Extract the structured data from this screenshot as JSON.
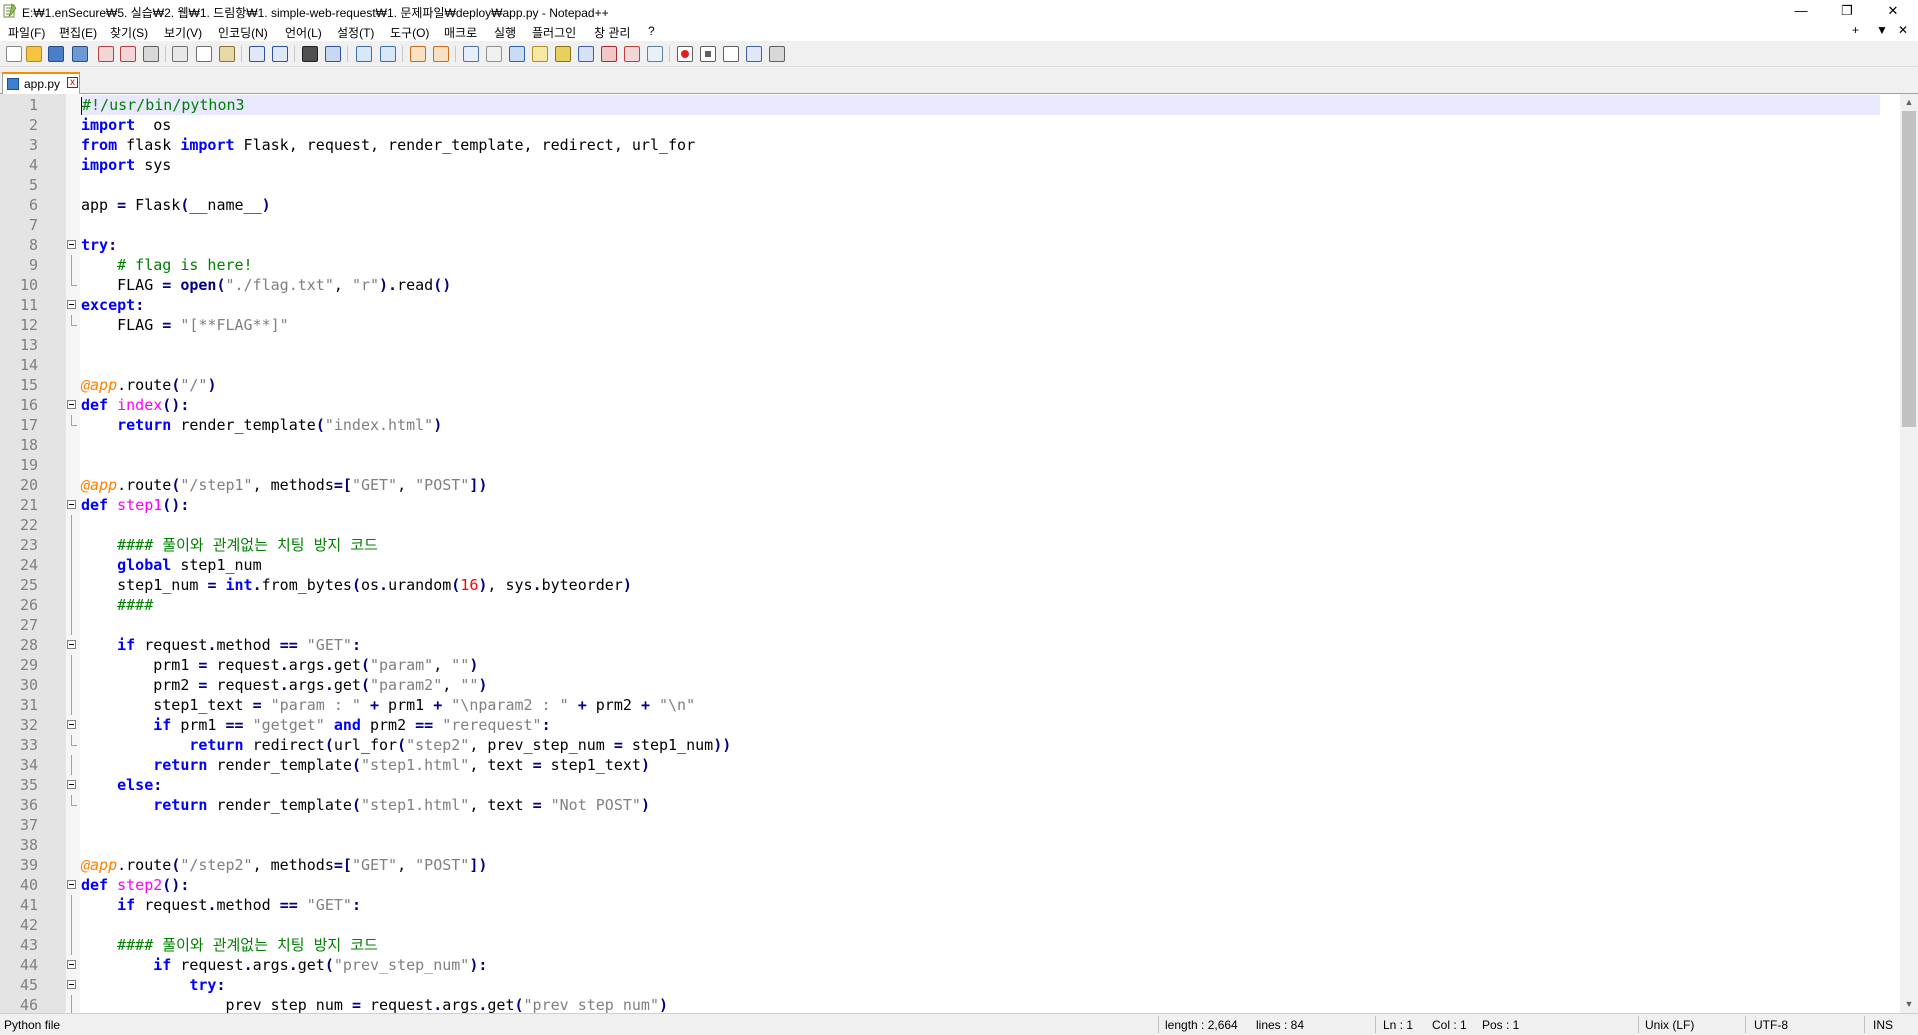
{
  "window": {
    "title": "E:₩1.enSecure₩5. 실습₩2. 웹₩1. 드림항₩1. simple-web-request₩1. 문제파일₩deploy₩app.py - Notepad++",
    "minimize": "—",
    "restore": "❐",
    "close": "✕"
  },
  "menu": {
    "items": [
      "파일(F)",
      "편집(E)",
      "찾기(S)",
      "보기(V)",
      "인코딩(N)",
      "언어(L)",
      "설정(T)",
      "도구(O)",
      "매크로",
      "실행",
      "플러그인",
      "창 관리",
      "?"
    ],
    "right_plus": "+",
    "right_down": "▼",
    "right_close": "✕"
  },
  "toolbar": {
    "icons": [
      "new-file",
      "open-file",
      "save",
      "save-all",
      "close",
      "close-all",
      "print",
      "cut",
      "copy",
      "paste",
      "undo",
      "redo",
      "find",
      "replace",
      "zoom-in",
      "zoom-out",
      "sync-vertical",
      "sync-horizontal",
      "word-wrap",
      "show-all-chars",
      "indent-guide",
      "user-language",
      "doc-map",
      "function-list",
      "folder-workspace",
      "doc-switcher",
      "monitoring",
      "record-macro",
      "stop-macro",
      "play-macro",
      "run-macro-multiple",
      "save-macro"
    ]
  },
  "tab": {
    "label": "app.py",
    "close": "x"
  },
  "colors": {
    "keyword": "#0000ff",
    "string": "#808080",
    "comment": "#008000",
    "number": "#ff0000",
    "decorator": "#ff8000",
    "function_name": "#ff00ff",
    "operator": "#000080",
    "current_line": "#e8e8ff",
    "tab_accent": "#fa8c00"
  },
  "editor": {
    "current_line": 1,
    "lines": [
      {
        "n": "1",
        "tokens": [
          [
            "cmt",
            "#!/usr/bin/python3"
          ]
        ]
      },
      {
        "n": "2",
        "tokens": [
          [
            "kw",
            "import"
          ],
          [
            "",
            "  os"
          ]
        ]
      },
      {
        "n": "3",
        "tokens": [
          [
            "kw",
            "from"
          ],
          [
            "",
            " flask "
          ],
          [
            "kw",
            "import"
          ],
          [
            "",
            " Flask, request, render_template, redirect, url_for"
          ]
        ]
      },
      {
        "n": "4",
        "tokens": [
          [
            "kw",
            "import"
          ],
          [
            "",
            " sys"
          ]
        ]
      },
      {
        "n": "5",
        "tokens": []
      },
      {
        "n": "6",
        "tokens": [
          [
            "",
            "app "
          ],
          [
            "op",
            "="
          ],
          [
            "",
            " Flask"
          ],
          [
            "op",
            "("
          ],
          [
            "",
            "__name__"
          ],
          [
            "op",
            ")"
          ]
        ]
      },
      {
        "n": "7",
        "tokens": []
      },
      {
        "n": "8",
        "fold": "start",
        "tokens": [
          [
            "kw",
            "try"
          ],
          [
            "op",
            ":"
          ]
        ]
      },
      {
        "n": "9",
        "fold": "line",
        "tokens": [
          [
            "",
            "    "
          ],
          [
            "cmt",
            "# flag is here!"
          ]
        ]
      },
      {
        "n": "10",
        "fold": "end",
        "tokens": [
          [
            "",
            "    FLAG "
          ],
          [
            "op",
            "="
          ],
          [
            "",
            " "
          ],
          [
            "kw2",
            "open"
          ],
          [
            "op",
            "("
          ],
          [
            "str",
            "\"./flag.txt\""
          ],
          [
            "",
            ", "
          ],
          [
            "str",
            "\"r\""
          ],
          [
            "op",
            ")."
          ],
          [
            "",
            "read"
          ],
          [
            "op",
            "()"
          ]
        ]
      },
      {
        "n": "11",
        "fold": "start",
        "tokens": [
          [
            "kw",
            "except"
          ],
          [
            "op",
            ":"
          ]
        ]
      },
      {
        "n": "12",
        "fold": "end",
        "tokens": [
          [
            "",
            "    FLAG "
          ],
          [
            "op",
            "="
          ],
          [
            "",
            " "
          ],
          [
            "str",
            "\"[**FLAG**]\""
          ]
        ]
      },
      {
        "n": "13",
        "tokens": []
      },
      {
        "n": "14",
        "tokens": []
      },
      {
        "n": "15",
        "tokens": [
          [
            "deco",
            "@app"
          ],
          [
            "",
            ".route"
          ],
          [
            "op",
            "("
          ],
          [
            "str",
            "\"/\""
          ],
          [
            "op",
            ")"
          ]
        ]
      },
      {
        "n": "16",
        "fold": "start",
        "tokens": [
          [
            "kw",
            "def"
          ],
          [
            "",
            " "
          ],
          [
            "fn",
            "index"
          ],
          [
            "op",
            "():"
          ]
        ]
      },
      {
        "n": "17",
        "fold": "end",
        "tokens": [
          [
            "",
            "    "
          ],
          [
            "kw",
            "return"
          ],
          [
            "",
            " render_template"
          ],
          [
            "op",
            "("
          ],
          [
            "str",
            "\"index.html\""
          ],
          [
            "op",
            ")"
          ]
        ]
      },
      {
        "n": "18",
        "tokens": []
      },
      {
        "n": "19",
        "tokens": []
      },
      {
        "n": "20",
        "tokens": [
          [
            "deco",
            "@app"
          ],
          [
            "",
            ".route"
          ],
          [
            "op",
            "("
          ],
          [
            "str",
            "\"/step1\""
          ],
          [
            "",
            ", methods"
          ],
          [
            "op",
            "=["
          ],
          [
            "str",
            "\"GET\""
          ],
          [
            "",
            ", "
          ],
          [
            "str",
            "\"POST\""
          ],
          [
            "op",
            "])"
          ]
        ]
      },
      {
        "n": "21",
        "fold": "start",
        "tokens": [
          [
            "kw",
            "def"
          ],
          [
            "",
            " "
          ],
          [
            "fn",
            "step1"
          ],
          [
            "op",
            "():"
          ]
        ]
      },
      {
        "n": "22",
        "fold": "line",
        "tokens": []
      },
      {
        "n": "23",
        "fold": "line",
        "tokens": [
          [
            "",
            "    "
          ],
          [
            "cmt",
            "#### 풀이와 관계없는 치팅 방지 코드"
          ]
        ]
      },
      {
        "n": "24",
        "fold": "line",
        "tokens": [
          [
            "",
            "    "
          ],
          [
            "kw",
            "global"
          ],
          [
            "",
            " step1_num"
          ]
        ]
      },
      {
        "n": "25",
        "fold": "line",
        "tokens": [
          [
            "",
            "    step1_num "
          ],
          [
            "op",
            "="
          ],
          [
            "",
            " "
          ],
          [
            "kw",
            "int"
          ],
          [
            "op",
            "."
          ],
          [
            "",
            "from_bytes"
          ],
          [
            "op",
            "("
          ],
          [
            "",
            "os"
          ],
          [
            "op",
            "."
          ],
          [
            "",
            "urandom"
          ],
          [
            "op",
            "("
          ],
          [
            "num",
            "16"
          ],
          [
            "op",
            ")"
          ],
          [
            "",
            ", sys"
          ],
          [
            "op",
            "."
          ],
          [
            "",
            "byteorder"
          ],
          [
            "op",
            ")"
          ]
        ]
      },
      {
        "n": "26",
        "fold": "line",
        "tokens": [
          [
            "",
            "    "
          ],
          [
            "cmt",
            "####"
          ]
        ]
      },
      {
        "n": "27",
        "fold": "line",
        "tokens": []
      },
      {
        "n": "28",
        "fold": "start",
        "tokens": [
          [
            "",
            "    "
          ],
          [
            "kw",
            "if"
          ],
          [
            "",
            " request"
          ],
          [
            "op",
            "."
          ],
          [
            "",
            "method "
          ],
          [
            "op",
            "=="
          ],
          [
            "",
            " "
          ],
          [
            "str",
            "\"GET\""
          ],
          [
            "op",
            ":"
          ]
        ]
      },
      {
        "n": "29",
        "fold": "line",
        "tokens": [
          [
            "",
            "        prm1 "
          ],
          [
            "op",
            "="
          ],
          [
            "",
            " request"
          ],
          [
            "op",
            "."
          ],
          [
            "",
            "args"
          ],
          [
            "op",
            "."
          ],
          [
            "",
            "get"
          ],
          [
            "op",
            "("
          ],
          [
            "str",
            "\"param\""
          ],
          [
            "",
            ", "
          ],
          [
            "str",
            "\"\""
          ],
          [
            "op",
            ")"
          ]
        ]
      },
      {
        "n": "30",
        "fold": "line",
        "tokens": [
          [
            "",
            "        prm2 "
          ],
          [
            "op",
            "="
          ],
          [
            "",
            " request"
          ],
          [
            "op",
            "."
          ],
          [
            "",
            "args"
          ],
          [
            "op",
            "."
          ],
          [
            "",
            "get"
          ],
          [
            "op",
            "("
          ],
          [
            "str",
            "\"param2\""
          ],
          [
            "",
            ", "
          ],
          [
            "str",
            "\"\""
          ],
          [
            "op",
            ")"
          ]
        ]
      },
      {
        "n": "31",
        "fold": "line",
        "tokens": [
          [
            "",
            "        step1_text "
          ],
          [
            "op",
            "="
          ],
          [
            "",
            " "
          ],
          [
            "str",
            "\"param : \""
          ],
          [
            "",
            " "
          ],
          [
            "op",
            "+"
          ],
          [
            "",
            " prm1 "
          ],
          [
            "op",
            "+"
          ],
          [
            "",
            " "
          ],
          [
            "str",
            "\"\\nparam2 : \""
          ],
          [
            "",
            " "
          ],
          [
            "op",
            "+"
          ],
          [
            "",
            " prm2 "
          ],
          [
            "op",
            "+"
          ],
          [
            "",
            " "
          ],
          [
            "str",
            "\"\\n\""
          ]
        ]
      },
      {
        "n": "32",
        "fold": "start",
        "tokens": [
          [
            "",
            "        "
          ],
          [
            "kw",
            "if"
          ],
          [
            "",
            " prm1 "
          ],
          [
            "op",
            "=="
          ],
          [
            "",
            " "
          ],
          [
            "str",
            "\"getget\""
          ],
          [
            "",
            " "
          ],
          [
            "kw",
            "and"
          ],
          [
            "",
            " prm2 "
          ],
          [
            "op",
            "=="
          ],
          [
            "",
            " "
          ],
          [
            "str",
            "\"rerequest\""
          ],
          [
            "op",
            ":"
          ]
        ]
      },
      {
        "n": "33",
        "fold": "end",
        "tokens": [
          [
            "",
            "            "
          ],
          [
            "kw",
            "return"
          ],
          [
            "",
            " redirect"
          ],
          [
            "op",
            "("
          ],
          [
            "",
            "url_for"
          ],
          [
            "op",
            "("
          ],
          [
            "str",
            "\"step2\""
          ],
          [
            "",
            ", prev_step_num "
          ],
          [
            "op",
            "="
          ],
          [
            "",
            " step1_num"
          ],
          [
            "op",
            "))"
          ]
        ]
      },
      {
        "n": "34",
        "fold": "line",
        "tokens": [
          [
            "",
            "        "
          ],
          [
            "kw",
            "return"
          ],
          [
            "",
            " render_template"
          ],
          [
            "op",
            "("
          ],
          [
            "str",
            "\"step1.html\""
          ],
          [
            "",
            ", text "
          ],
          [
            "op",
            "="
          ],
          [
            "",
            " step1_text"
          ],
          [
            "op",
            ")"
          ]
        ]
      },
      {
        "n": "35",
        "fold": "start",
        "tokens": [
          [
            "",
            "    "
          ],
          [
            "kw",
            "else"
          ],
          [
            "op",
            ":"
          ]
        ]
      },
      {
        "n": "36",
        "fold": "end",
        "tokens": [
          [
            "",
            "        "
          ],
          [
            "kw",
            "return"
          ],
          [
            "",
            " render_template"
          ],
          [
            "op",
            "("
          ],
          [
            "str",
            "\"step1.html\""
          ],
          [
            "",
            ", text "
          ],
          [
            "op",
            "="
          ],
          [
            "",
            " "
          ],
          [
            "str",
            "\"Not POST\""
          ],
          [
            "op",
            ")"
          ]
        ]
      },
      {
        "n": "37",
        "tokens": []
      },
      {
        "n": "38",
        "tokens": []
      },
      {
        "n": "39",
        "tokens": [
          [
            "deco",
            "@app"
          ],
          [
            "",
            ".route"
          ],
          [
            "op",
            "("
          ],
          [
            "str",
            "\"/step2\""
          ],
          [
            "",
            ", methods"
          ],
          [
            "op",
            "=["
          ],
          [
            "str",
            "\"GET\""
          ],
          [
            "",
            ", "
          ],
          [
            "str",
            "\"POST\""
          ],
          [
            "op",
            "])"
          ]
        ]
      },
      {
        "n": "40",
        "fold": "start",
        "tokens": [
          [
            "kw",
            "def"
          ],
          [
            "",
            " "
          ],
          [
            "fn",
            "step2"
          ],
          [
            "op",
            "():"
          ]
        ]
      },
      {
        "n": "41",
        "fold": "line",
        "tokens": [
          [
            "",
            "    "
          ],
          [
            "kw",
            "if"
          ],
          [
            "",
            " request"
          ],
          [
            "op",
            "."
          ],
          [
            "",
            "method "
          ],
          [
            "op",
            "=="
          ],
          [
            "",
            " "
          ],
          [
            "str",
            "\"GET\""
          ],
          [
            "op",
            ":"
          ]
        ]
      },
      {
        "n": "42",
        "fold": "line",
        "tokens": []
      },
      {
        "n": "43",
        "fold": "line",
        "tokens": [
          [
            "",
            "    "
          ],
          [
            "cmt",
            "#### 풀이와 관계없는 치팅 방지 코드"
          ]
        ]
      },
      {
        "n": "44",
        "fold": "start",
        "tokens": [
          [
            "",
            "        "
          ],
          [
            "kw",
            "if"
          ],
          [
            "",
            " request"
          ],
          [
            "op",
            "."
          ],
          [
            "",
            "args"
          ],
          [
            "op",
            "."
          ],
          [
            "",
            "get"
          ],
          [
            "op",
            "("
          ],
          [
            "str",
            "\"prev_step_num\""
          ],
          [
            "op",
            "):"
          ]
        ]
      },
      {
        "n": "45",
        "fold": "start",
        "tokens": [
          [
            "",
            "            "
          ],
          [
            "kw",
            "try"
          ],
          [
            "op",
            ":"
          ]
        ]
      },
      {
        "n": "46",
        "fold": "line",
        "tokens": [
          [
            "",
            "                prev_step_num "
          ],
          [
            "op",
            "="
          ],
          [
            "",
            " request"
          ],
          [
            "op",
            "."
          ],
          [
            "",
            "args"
          ],
          [
            "op",
            "."
          ],
          [
            "",
            "get"
          ],
          [
            "op",
            "("
          ],
          [
            "str",
            "\"prev_step_num\""
          ],
          [
            "op",
            ")"
          ]
        ]
      }
    ]
  },
  "statusbar": {
    "file_type": "Python file",
    "length": "length : 2,664",
    "lines": "lines : 84",
    "ln": "Ln : 1",
    "col": "Col : 1",
    "pos": "Pos : 1",
    "eol": "Unix (LF)",
    "encoding": "UTF-8",
    "mode": "INS"
  }
}
